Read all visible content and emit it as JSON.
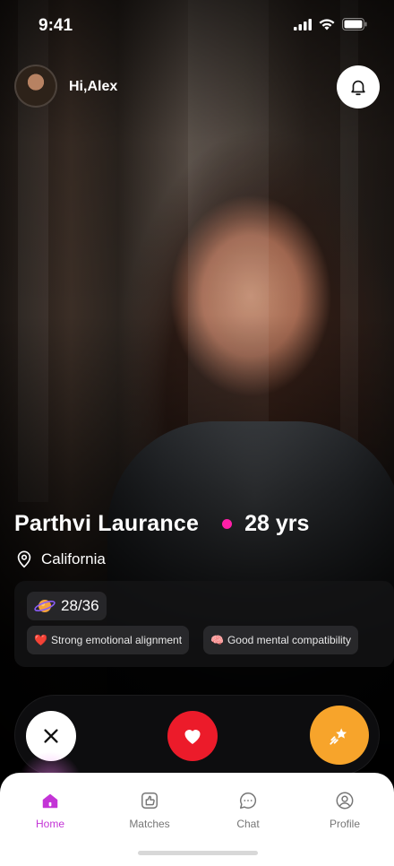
{
  "status_bar": {
    "time": "9:41"
  },
  "header": {
    "greeting": "Hi,Alex"
  },
  "profile": {
    "name": "Parthvi Laurance",
    "age": "28 yrs",
    "location": "California",
    "compatibility_score": "28/36",
    "tags": [
      {
        "emoji": "❤️",
        "label": "Strong emotional alignment"
      },
      {
        "emoji": "🧠",
        "label": "Good mental compatibility"
      }
    ]
  },
  "actions": {
    "dislike_icon": "close-icon",
    "like_icon": "heart-icon",
    "super_like_icon": "shooting-star-icon"
  },
  "bottom_nav": {
    "items": [
      {
        "label": "Home",
        "icon": "home-icon",
        "active": true
      },
      {
        "label": "Matches",
        "icon": "thumbs-up-icon",
        "active": false
      },
      {
        "label": "Chat",
        "icon": "chat-icon",
        "active": false
      },
      {
        "label": "Profile",
        "icon": "user-icon",
        "active": false
      }
    ]
  },
  "colors": {
    "accent": "#c334d6",
    "like": "#ec1b2a",
    "super_like": "#f7a42b",
    "online_dot": "#ff1fa8"
  }
}
